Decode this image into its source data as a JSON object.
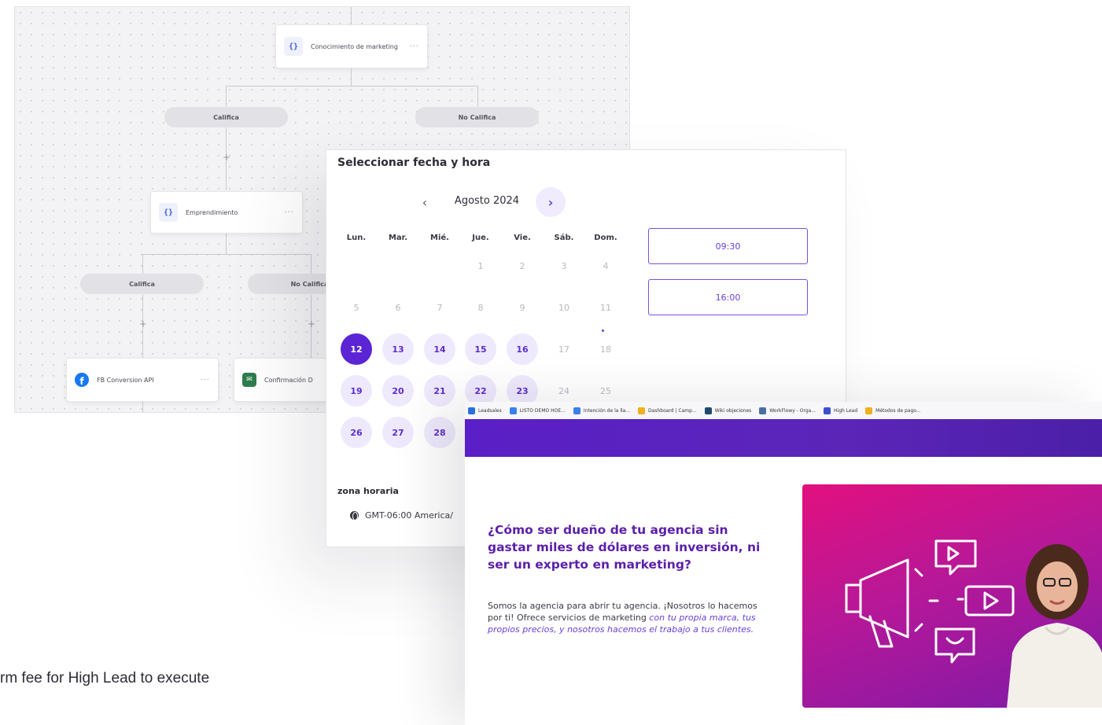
{
  "workflow": {
    "node_marketing": "Conocimiento de marketing",
    "node_emprendimiento": "Emprendimiento",
    "node_fb": "FB Conversion API",
    "node_confirmacion": "Confirmación D",
    "pill_califica_1": "Califica",
    "pill_no_califica_1": "No Califica",
    "pill_califica_2": "Califica",
    "pill_no_califica_2": "No Califica",
    "more": "···",
    "plus": "+"
  },
  "calendar": {
    "title": "Seleccionar fecha y hora",
    "month": "Agosto 2024",
    "prev": "‹",
    "next": "›",
    "weekdays": [
      "Lun.",
      "Mar.",
      "Mié.",
      "Jue.",
      "Vie.",
      "Sáb.",
      "Dom."
    ],
    "rows": [
      [
        "",
        "",
        "",
        "1",
        "2",
        "3",
        "4"
      ],
      [
        "5",
        "6",
        "7",
        "8",
        "9",
        "10",
        "11"
      ],
      [
        "12",
        "13",
        "14",
        "15",
        "16",
        "17",
        "18"
      ],
      [
        "19",
        "20",
        "21",
        "22",
        "23",
        "24",
        "25"
      ],
      [
        "26",
        "27",
        "28",
        "",
        "",
        "",
        ""
      ]
    ],
    "selected_day": "12",
    "available_days": [
      "13",
      "14",
      "15",
      "16",
      "19",
      "20",
      "21",
      "22",
      "23",
      "26",
      "27",
      "28"
    ],
    "time_slots": [
      "09:30",
      "16:00"
    ],
    "timezone_label": "zona horaria",
    "timezone_value": "GMT-06:00 America/"
  },
  "browser": {
    "bookmarks": [
      {
        "label": "Leadsales",
        "color": "#2b6de0"
      },
      {
        "label": "LISTO DEMO HOE...",
        "color": "#3b7ff0"
      },
      {
        "label": "Intención de la lla...",
        "color": "#3b7ff0"
      },
      {
        "label": "Dashboard | Camp...",
        "color": "#f2b01e"
      },
      {
        "label": "Wiki objeciones",
        "color": "#1f4a6b"
      },
      {
        "label": "WorkFlowy - Orga...",
        "color": "#4a6fa5"
      },
      {
        "label": "High Lead",
        "color": "#3b4fd0"
      },
      {
        "label": "Métodos de pago...",
        "color": "#f2b01e"
      }
    ],
    "headline": "¿Cómo ser dueño de tu agencia sin gastar miles de dólares en inversión, ni ser un experto en marketing?",
    "body": "Somos la agencia para abrir tu agencia. ¡Nosotros lo hacemos por ti! Ofrece servicios de marketing",
    "body_italic": "con tu propia marca, tus propios precios, y nosotros hacemos el trabajo a tus clientes."
  },
  "caption": "rm fee for High Lead to execute",
  "colors": {
    "accent_purple": "#5b24d4",
    "hero_pink": "#e2107f",
    "hero_violet": "#7d1aa8"
  }
}
